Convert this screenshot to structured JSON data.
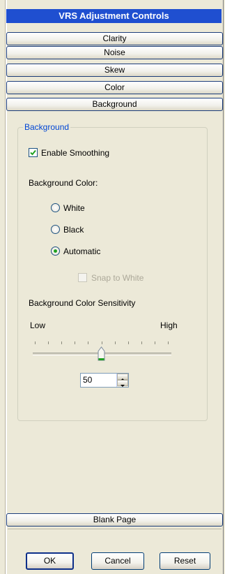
{
  "window": {
    "title": "VRS Adjustment Controls"
  },
  "sections": [
    {
      "label": "Clarity"
    },
    {
      "label": "Noise"
    },
    {
      "label": "Skew"
    },
    {
      "label": "Color"
    },
    {
      "label": "Background"
    }
  ],
  "background": {
    "group_label": "Background",
    "enable_smoothing_label": "Enable Smoothing",
    "enable_smoothing_checked": true,
    "color_label": "Background Color:",
    "color_options": [
      {
        "label": "White",
        "selected": false
      },
      {
        "label": "Black",
        "selected": false
      },
      {
        "label": "Automatic",
        "selected": true
      }
    ],
    "snap_label": "Snap to White",
    "snap_checked": false,
    "sensitivity_label": "Background Color Sensitivity",
    "low_label": "Low",
    "high_label": "High",
    "sensitivity_value": "50",
    "sensitivity_fraction": 0.5
  },
  "footer_section": {
    "label": "Blank Page"
  },
  "buttons": {
    "ok": "OK",
    "cancel": "Cancel",
    "reset": "Reset"
  },
  "colors": {
    "title_bg": "#1f4fd0",
    "accent": "#0046d5",
    "check": "#21a121"
  }
}
